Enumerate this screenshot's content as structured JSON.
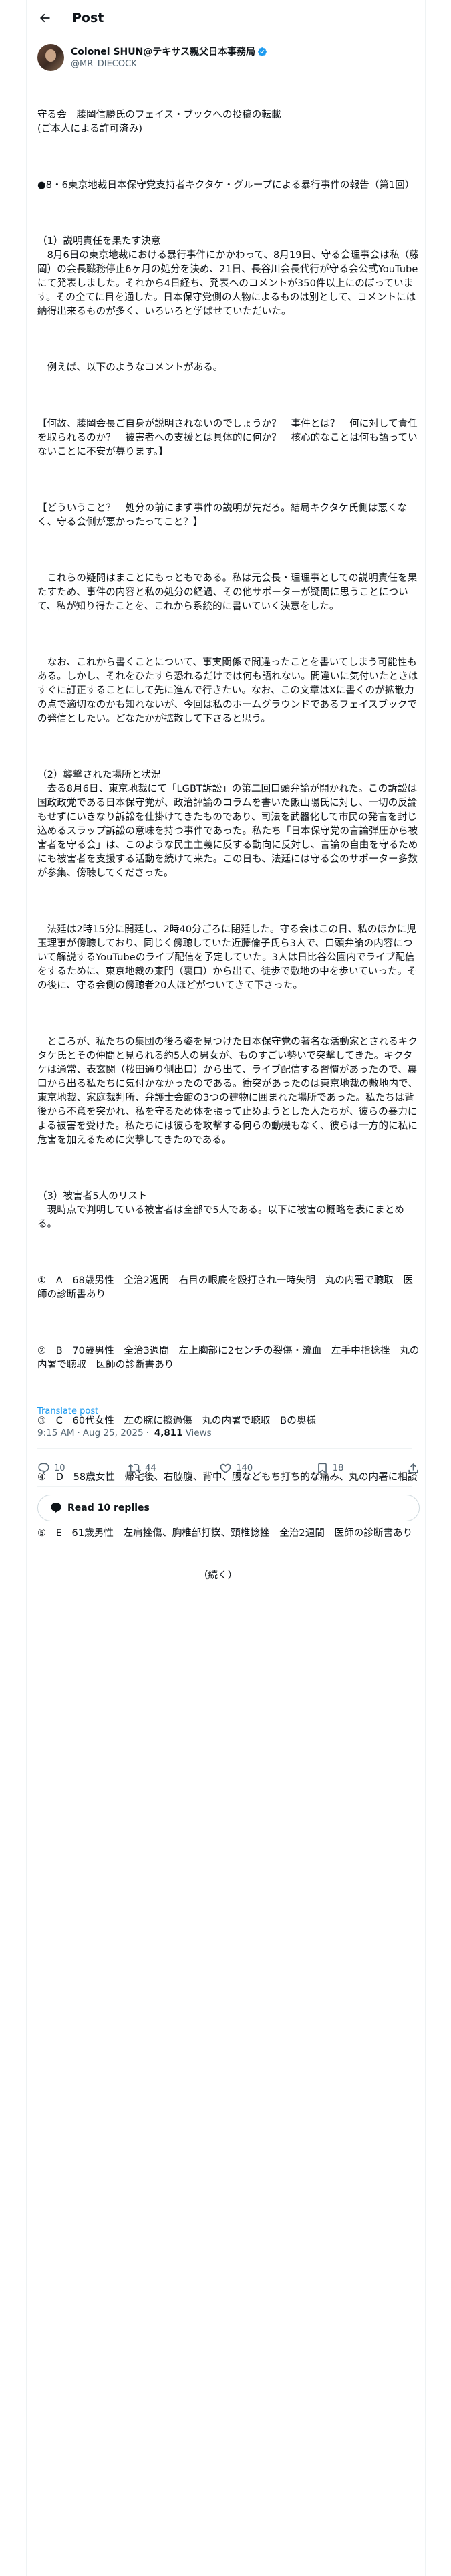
{
  "header": {
    "title": "Post"
  },
  "author": {
    "display_name": "Colonel SHUN@テキサス親父日本事務局",
    "handle": "@MR_DIECOCK"
  },
  "post": {
    "paragraphs": [
      "守る会　藤岡信勝氏のフェイス・ブックへの投稿の転載\n(ご本人による許可済み)",
      "●8・6東京地裁日本保守党支持者キクタケ・グループによる暴行事件の報告（第1回）",
      "（1）説明責任を果たす決意\n　8月6日の東京地裁における暴行事件にかかわって、8月19日、守る会理事会は私（藤岡）の会長職務停止6ヶ月の処分を決め、21日、長谷川会長代行が守る会公式YouTubeにて発表しました。それから4日経ち、発表へのコメントが350件以上にのぼっています。その全てに目を通した。日本保守党側の人物によるものは別として、コメントには納得出来るものが多く、いろいろと学ばせていただいた。",
      "　例えば、以下のようなコメントがある。",
      "【何故、藤岡会長ご自身が説明されないのでしょうか？　事件とは？　何に対して責任を取られるのか？　被害者への支援とは具体的に何か？　核心的なことは何も語っていないことに不安が募ります。】",
      "【どういうこと？　処分の前にまず事件の説明が先だろ。結局キクタケ氏側は悪くなく、守る会側が悪かったってこと？】",
      "　これらの疑問はまことにもっともである。私は元会長・理理事としての説明責任を果たすため、事件の内容と私の処分の経過、その他サポーターが疑問に思うことについて、私が知り得たことを、これから系統的に書いていく決意をした。",
      "　なお、これから書くことについて、事実関係で間違ったことを書いてしまう可能性もある。しかし、それをひたすら恐れるだけでは何も語れない。間違いに気付いたときはすぐに訂正することにして先に進んで行きたい。なお、この文章はXに書くのが拡散力の点で適切なのかも知れないが、今回は私のホームグラウンドであるフェイスブックでの発信としたい。どなたかが拡散して下さると思う。",
      "（2）襲撃された場所と状況\n　去る8月6日、東京地裁にて「LGBT訴訟」の第二回口頭弁論が開かれた。この訴訟は国政政党である日本保守党が、政治評論のコラムを書いた飯山陽氏に対し、一切の反論もせずにいきなり訴訟を仕掛けてきたものであり、司法を武器化して市民の発言を封じ込めるスラップ訴訟の意味を持つ事件であった。私たち「日本保守党の言論弾圧から被害者を守る会」は、このような民主主義に反する動向に反対し、言論の自由を守るためにも被害者を支援する活動を続けて来た。この日も、法廷には守る会のサポーター多数が参集、傍聴してくださった。",
      "　法廷は2時15分に開廷し、2時40分ごろに閉廷した。守る会はこの日、私のほかに児玉理事が傍聴しており、同じく傍聴していた近藤倫子氏ら3人で、口頭弁論の内容について解説するYouTubeのライブ配信を予定していた。3人は日比谷公園内でライブ配信をするために、東京地裁の東門（裏口）から出て、徒歩で敷地の中を歩いていった。その後に、守る会側の傍聴者20人ほどがついてきて下さった。",
      "　ところが、私たちの集団の後ろ姿を見つけた日本保守党の著名な活動家とされるキクタケ氏とその仲間と見られる約5人の男女が、ものすごい勢いで突撃してきた。キクタケは通常、表玄関（桜田通り側出口）から出て、ライブ配信する習慣があったので、裏口から出る私たちに気付かなかったのである。衝突があったのは東京地裁の敷地内で、東京地裁、家庭裁判所、弁護士会館の3つの建物に囲まれた場所であった。私たちは背後から不意を突かれ、私を守るため体を張って止めようとした人たちが、彼らの暴力による被害を受けた。私たちには彼らを攻撃する何らの動機もなく、彼らは一方的に私に危害を加えるために突撃してきたのである。",
      "（3）被害者5人のリスト\n　現時点で判明している被害者は全部で5人である。以下に被害の概略を表にまとめる。",
      "①　A　68歳男性　全治2週間　右目の眼底を殴打され一時失明　丸の内署で聴取　医師の診断書あり",
      "②　B　70歳男性　全治3週間　左上胸部に2センチの裂傷・流血　左手中指捻挫　丸の内署で聴取　医師の診断書あり",
      "③　C　60代女性　左の腕に擦過傷　丸の内署で聴取　Bの奥様",
      "④　D　58歳女性　帰宅後、右脇腹、背中、腰などもち打ち的な痛み、丸の内署に相談",
      "⑤　E　61歳男性　左肩挫傷、胸椎部打撲、頸椎捻挫　全治2週間　医師の診断書あり",
      "　　　　　　　　　　　　　　　　　（続く）"
    ]
  },
  "translate_label": "Translate post",
  "meta": {
    "time": "9:15 AM",
    "date": "Aug 25, 2025",
    "separator": "·",
    "views_count": "4,811",
    "views_label": "Views"
  },
  "actions": {
    "replies": "10",
    "reposts": "44",
    "likes": "140",
    "bookmarks": "18"
  },
  "read_replies_label": "Read 10 replies",
  "colors": {
    "accent": "#1d9bf0",
    "text": "#0f1419",
    "secondary": "#536471",
    "border": "#eff3f4"
  }
}
